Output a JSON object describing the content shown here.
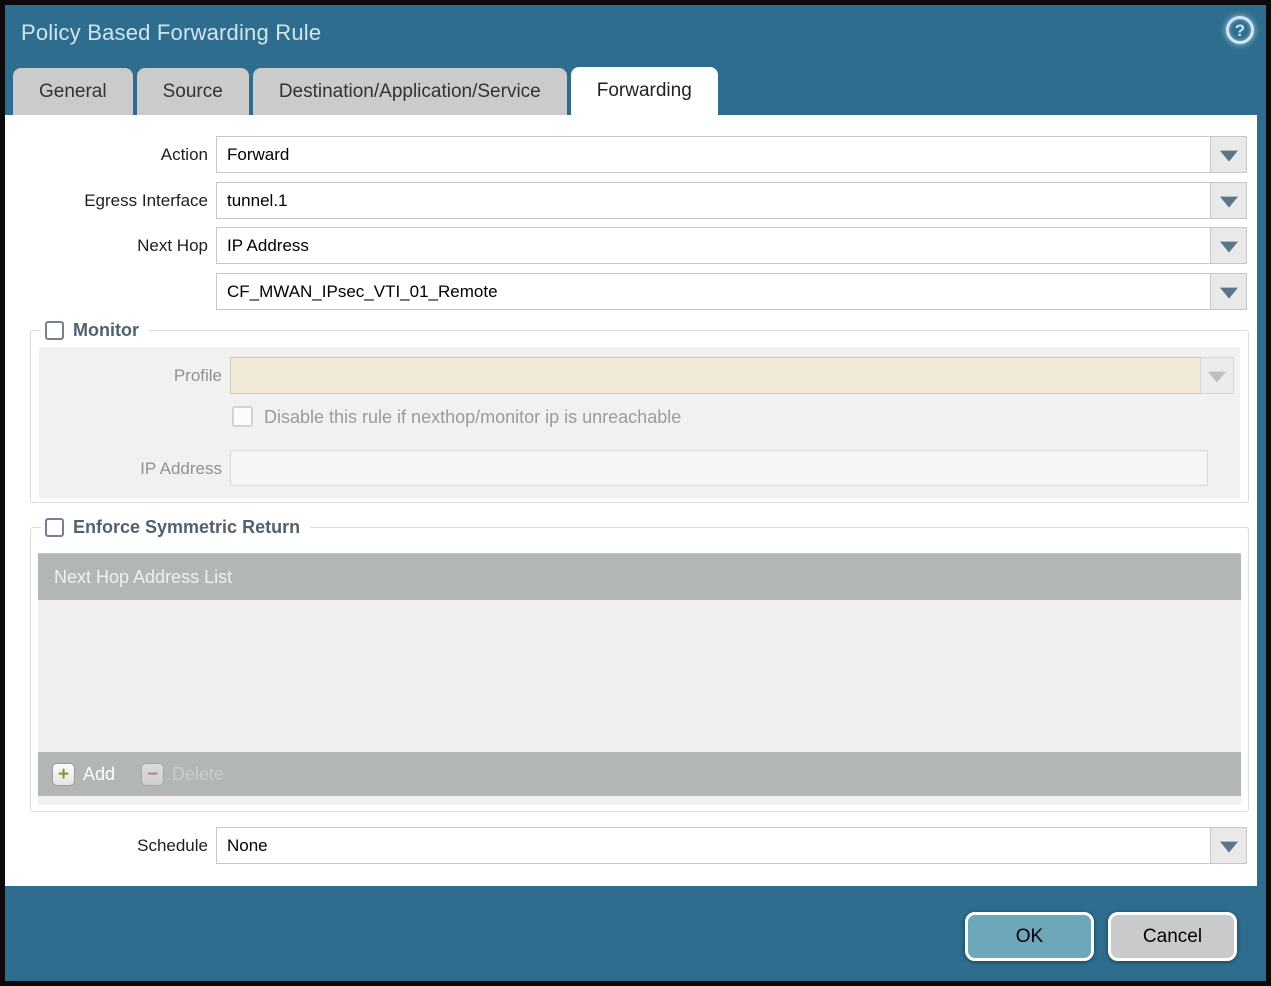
{
  "window": {
    "title": "Policy Based Forwarding Rule"
  },
  "icons": {
    "help": "?",
    "add": "+",
    "delete": "−"
  },
  "tabs": [
    {
      "label": "General",
      "active": false
    },
    {
      "label": "Source",
      "active": false
    },
    {
      "label": "Destination/Application/Service",
      "active": false
    },
    {
      "label": "Forwarding",
      "active": true
    }
  ],
  "form": {
    "action_label": "Action",
    "action_value": "Forward",
    "egress_label": "Egress Interface",
    "egress_value": "tunnel.1",
    "next_hop_label": "Next Hop",
    "next_hop_value": "IP Address",
    "next_hop_address_value": "CF_MWAN_IPsec_VTI_01_Remote",
    "schedule_label": "Schedule",
    "schedule_value": "None"
  },
  "monitor": {
    "title": "Monitor",
    "checked": false,
    "profile_label": "Profile",
    "profile_value": "",
    "disable_label": "Disable this rule if nexthop/monitor ip is unreachable",
    "disable_checked": false,
    "ip_label": "IP Address",
    "ip_value": ""
  },
  "symmetric": {
    "title": "Enforce Symmetric Return",
    "checked": false,
    "table_header": "Next Hop Address List",
    "rows": [],
    "add_label": "Add",
    "delete_label": "Delete"
  },
  "footer": {
    "ok": "OK",
    "cancel": "Cancel"
  },
  "colors": {
    "titlebar": "#2e6d8e",
    "ok_button": "#6ea6ba",
    "beige_input": "#f0e9d8",
    "table_gray": "#b2b6b7",
    "section_title": "#50616f"
  }
}
